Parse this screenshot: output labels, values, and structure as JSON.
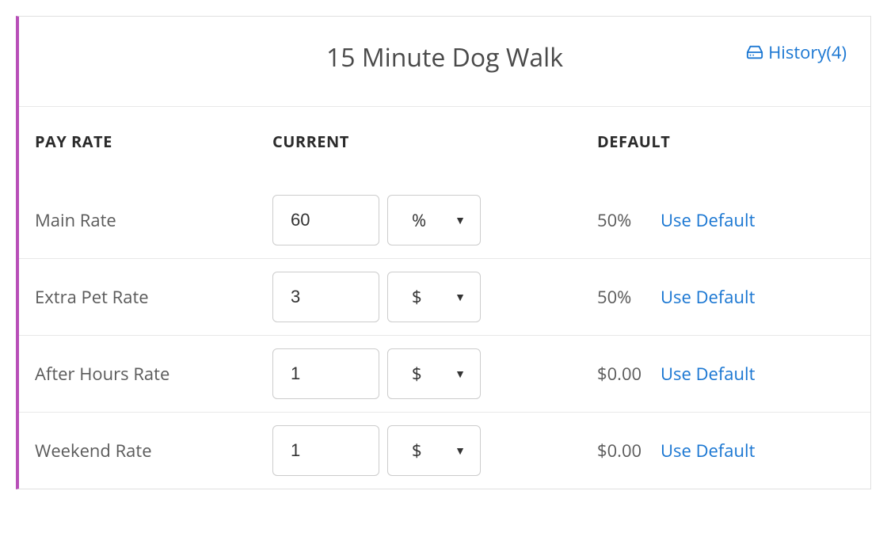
{
  "header": {
    "title": "15 Minute Dog Walk",
    "history_label": "History",
    "history_count": "(4)"
  },
  "columns": {
    "pay_rate": "Pay Rate",
    "current": "Current",
    "default": "Default"
  },
  "labels": {
    "use_default": "Use Default"
  },
  "rows": [
    {
      "label": "Main Rate",
      "value": "60",
      "unit": "%",
      "default": "50%"
    },
    {
      "label": "Extra Pet Rate",
      "value": "3",
      "unit": "$",
      "default": "50%"
    },
    {
      "label": "After Hours Rate",
      "value": "1",
      "unit": "$",
      "default": "$0.00"
    },
    {
      "label": "Weekend Rate",
      "value": "1",
      "unit": "$",
      "default": "$0.00"
    }
  ]
}
